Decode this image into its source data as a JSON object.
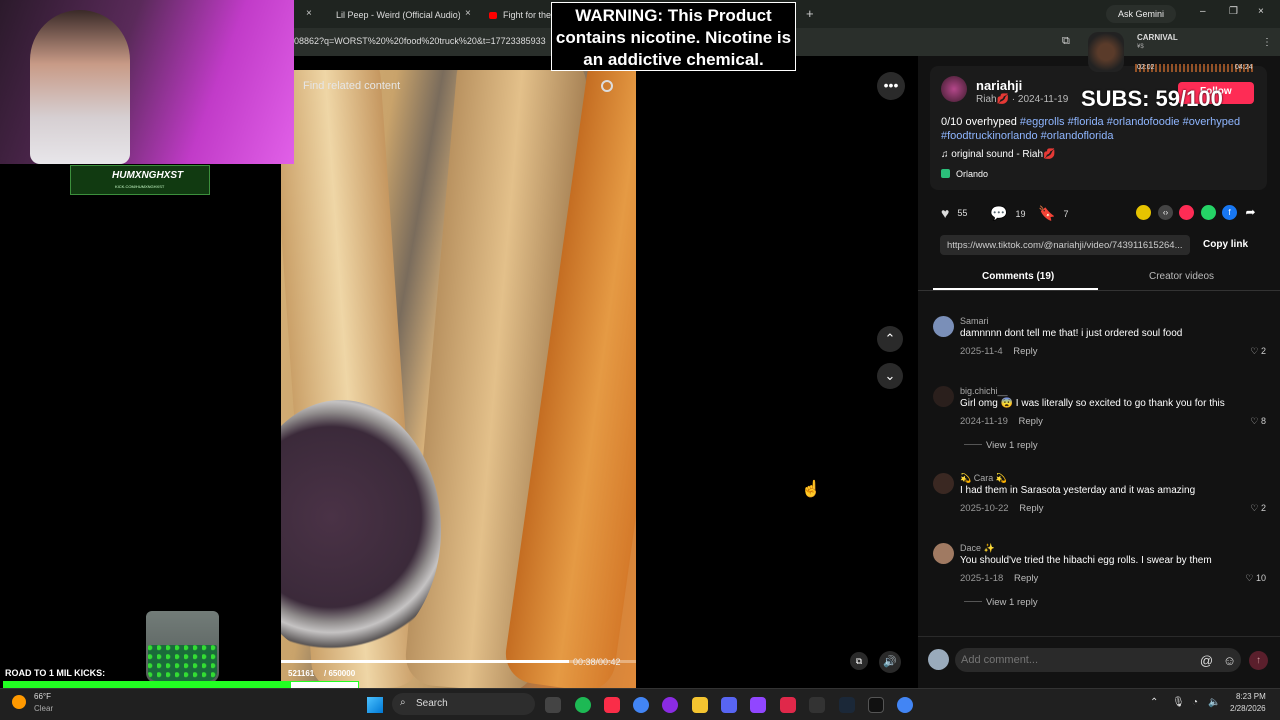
{
  "browser": {
    "tabs": [
      {
        "title": "Lil Peep - Weird (Official Audio)"
      },
      {
        "title": "Fight for the"
      }
    ],
    "url": "08862?q=WORST%20%20food%20truck%20&t=17723385933",
    "ask_gemini": "Ask Gemini",
    "new_tab": "+",
    "close_glyph": "×",
    "window_controls": [
      "–",
      "❐",
      "×"
    ]
  },
  "video": {
    "search_placeholder": "Find related content",
    "progress_fraction": 0.81,
    "time": "00:38/00:42"
  },
  "player_controls": {
    "more": "•••",
    "prev": "⌃",
    "next": "⌄",
    "volume": "🔊",
    "pip": "⧉"
  },
  "post": {
    "username": "nariahji",
    "subline": "Riah💋 · 2024-11-19",
    "caption_text": "0/10 overhyped",
    "hashtags": "#eggrolls #florida #orlandofoodie #overhyped #foodtruckinorlando #orlandoflorida",
    "sound": "original sound - Riah💋",
    "location": "Orlando",
    "likes": "55",
    "comments_count": "19",
    "saves": "7",
    "link": "https://www.tiktok.com/@nariahji/video/743911615264...",
    "copy_link": "Copy link",
    "follow": "Follow"
  },
  "tabs": {
    "comments": "Comments (19)",
    "creator": "Creator videos"
  },
  "comments": [
    {
      "user": "Samari",
      "text": "damnnnn dont tell me that! i just ordered soul food",
      "date": "2025-11-4",
      "reply": "Reply",
      "likes": "2",
      "more": ""
    },
    {
      "user": "big.chichi__",
      "text": "Girl omg 😨 I was literally so excited to go thank you for this",
      "date": "2024-11-19",
      "reply": "Reply",
      "likes": "8",
      "more": "View 1 reply"
    },
    {
      "user": "💫 Cara 💫",
      "text": "I had them in Sarasota yesterday and it was amazing",
      "date": "2025-10-22",
      "reply": "Reply",
      "likes": "2",
      "more": ""
    },
    {
      "user": "Dace ✨",
      "text": "You should've tried the hibachi egg rolls. I swear by them",
      "date": "2025-1-18",
      "reply": "Reply",
      "likes": "10",
      "more": "View 1 reply"
    }
  ],
  "comment_input": {
    "placeholder": "Add comment..."
  },
  "overlays": {
    "warning": "WARNING: This Product contains nicotine. Nicotine is an addictive chemical.",
    "subs": "SUBS: 59/100",
    "logo_text": "HUMXNGHXST",
    "logo_sub": "KICK.COM/HUMXNGHXST",
    "road_label": "ROAD TO 1 MIL KICKS:",
    "road_fraction": 0.81,
    "music_title": "CARNIVAL",
    "music_sub": "¥$",
    "music_start": "02:02",
    "music_end": "04:24",
    "video_counter": "521161",
    "video_goal": "/ 650000"
  },
  "taskbar": {
    "weather_temp": "66°F",
    "weather_cond": "Clear",
    "search": "Search",
    "time": "8:23 PM",
    "date": "2/28/2026"
  },
  "colors": {
    "accent": "#fe2c55",
    "hashtag": "#8fb6ff",
    "road_fill": "#22ff22"
  }
}
